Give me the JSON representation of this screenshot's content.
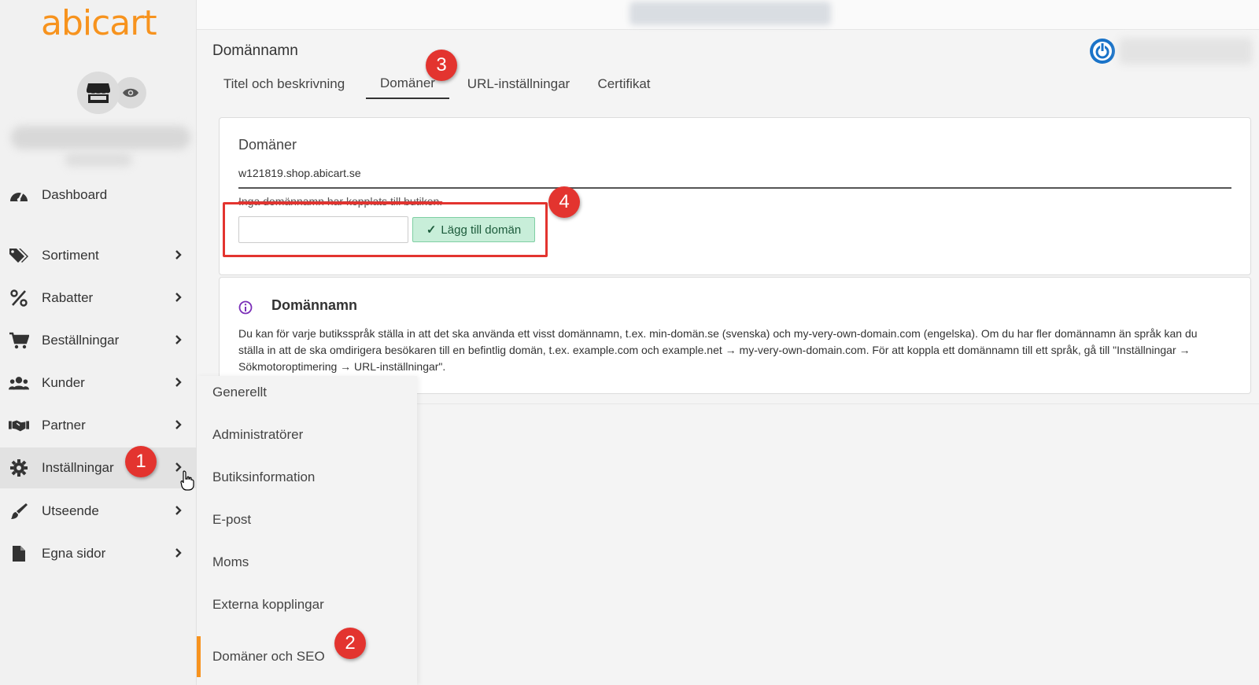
{
  "brand": {
    "logo_text": "abicart",
    "accent_color": "#f7931e"
  },
  "sidebar": {
    "store_icon": "store-icon",
    "preview_icon": "eye-icon",
    "items": [
      {
        "label": "Dashboard",
        "icon": "dashboard-gauge-icon",
        "has_chevron": false
      },
      {
        "label": "Sortiment",
        "icon": "tags-icon",
        "has_chevron": true
      },
      {
        "label": "Rabatter",
        "icon": "percent-icon",
        "has_chevron": true
      },
      {
        "label": "Beställningar",
        "icon": "cart-icon",
        "has_chevron": true
      },
      {
        "label": "Kunder",
        "icon": "users-icon",
        "has_chevron": true
      },
      {
        "label": "Partner",
        "icon": "handshake-icon",
        "has_chevron": true
      },
      {
        "label": "Inställningar",
        "icon": "gear-icon",
        "has_chevron": true,
        "active": true
      },
      {
        "label": "Utseende",
        "icon": "brush-icon",
        "has_chevron": true
      },
      {
        "label": "Egna sidor",
        "icon": "file-icon",
        "has_chevron": true
      }
    ]
  },
  "submenu": {
    "items": [
      {
        "label": "Generellt"
      },
      {
        "label": "Administratörer"
      },
      {
        "label": "Butiksinformation"
      },
      {
        "label": "E-post"
      },
      {
        "label": "Moms"
      },
      {
        "label": "Externa kopplingar"
      },
      {
        "label": "Domäner och SEO",
        "active": true
      }
    ]
  },
  "header": {
    "title": "Domännamn",
    "power_icon": "power-icon"
  },
  "tabs": [
    {
      "label": "Titel och beskrivning"
    },
    {
      "label": "Domäner",
      "active": true
    },
    {
      "label": "URL-inställningar"
    },
    {
      "label": "Certifikat"
    }
  ],
  "domains_card": {
    "title": "Domäner",
    "current_domain": "w121819.shop.abicart.se",
    "no_domain_text": "Inga domännamn har kopplats till butiken.",
    "input_value": "",
    "add_button_label": "Lägg till domän"
  },
  "info_card": {
    "title": "Domännamn",
    "text": "Du kan för varje butiksspråk ställa in att det ska använda ett visst domännamn, t.ex. min-domän.se (svenska) och my-very-own-domain.com (engelska). Om du har fler domännamn än språk kan du ställa in att de ska omdirigera besökaren till en befintlig domän, t.ex. example.com och example.net → my-very-own-domain.com. För att koppla ett domännamn till ett språk, gå till \"Inställningar → Sökmotoroptimering → URL-inställningar\"."
  },
  "annotations": [
    {
      "number": "1"
    },
    {
      "number": "2"
    },
    {
      "number": "3"
    },
    {
      "number": "4"
    }
  ]
}
